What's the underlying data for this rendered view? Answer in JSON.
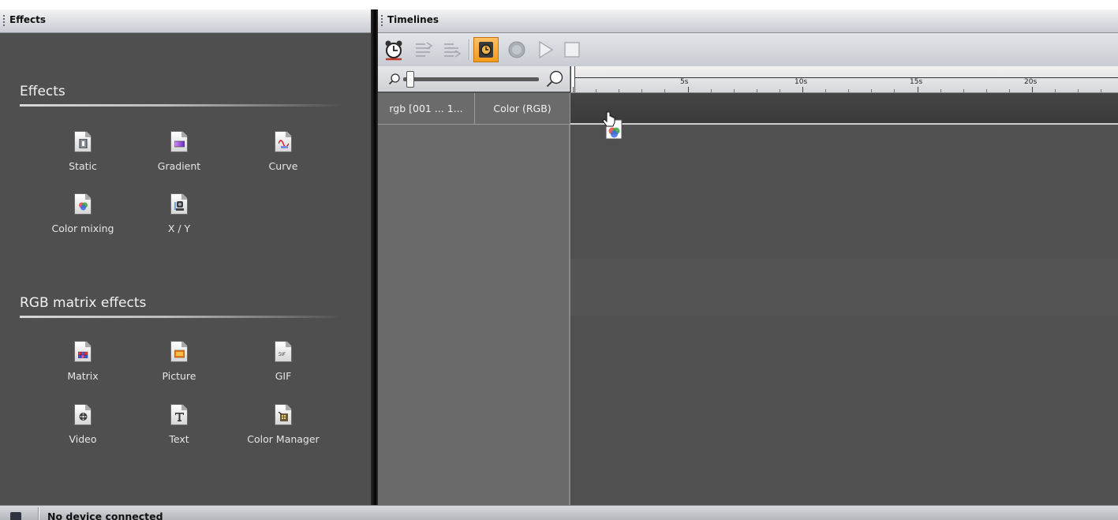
{
  "effects_panel": {
    "title": "Effects",
    "sections": [
      {
        "title": "Effects",
        "items": [
          {
            "label": "Static",
            "icon": "static-effect-icon"
          },
          {
            "label": "Gradient",
            "icon": "gradient-effect-icon"
          },
          {
            "label": "Curve",
            "icon": "curve-effect-icon"
          },
          {
            "label": "Color mixing",
            "icon": "color-mixing-effect-icon"
          },
          {
            "label": "X / Y",
            "icon": "xy-effect-icon"
          }
        ]
      },
      {
        "title": "RGB matrix effects",
        "items": [
          {
            "label": "Matrix",
            "icon": "matrix-effect-icon"
          },
          {
            "label": "Picture",
            "icon": "picture-effect-icon"
          },
          {
            "label": "GIF",
            "icon": "gif-effect-icon"
          },
          {
            "label": "Video",
            "icon": "video-effect-icon"
          },
          {
            "label": "Text",
            "icon": "text-effect-icon"
          },
          {
            "label": "Color Manager",
            "icon": "color-manager-effect-icon"
          }
        ]
      }
    ]
  },
  "timelines_panel": {
    "title": "Timelines",
    "toolbar": [
      {
        "name": "alarm-clock-icon",
        "active": false
      },
      {
        "name": "lines-arrow-right-icon",
        "active": false
      },
      {
        "name": "lines-arrow-right-alt-icon",
        "active": false
      },
      {
        "name": "timecode-sync-icon",
        "active": true
      },
      {
        "name": "record-icon",
        "active": false
      },
      {
        "name": "play-icon",
        "active": false
      },
      {
        "name": "stop-icon",
        "active": false
      }
    ],
    "ruler_labels": [
      "5s",
      "10s",
      "15s",
      "20s"
    ],
    "track": {
      "name": "rgb [001 ... 1...",
      "type": "Color (RGB)"
    }
  },
  "status_bar": {
    "text": "No device connected"
  },
  "colors": {
    "panel_bg": "#4f4f4f",
    "header_bg": "#d9dbe0",
    "active_tool": "#f39a1a",
    "track_bg": "#6b6b6b"
  }
}
